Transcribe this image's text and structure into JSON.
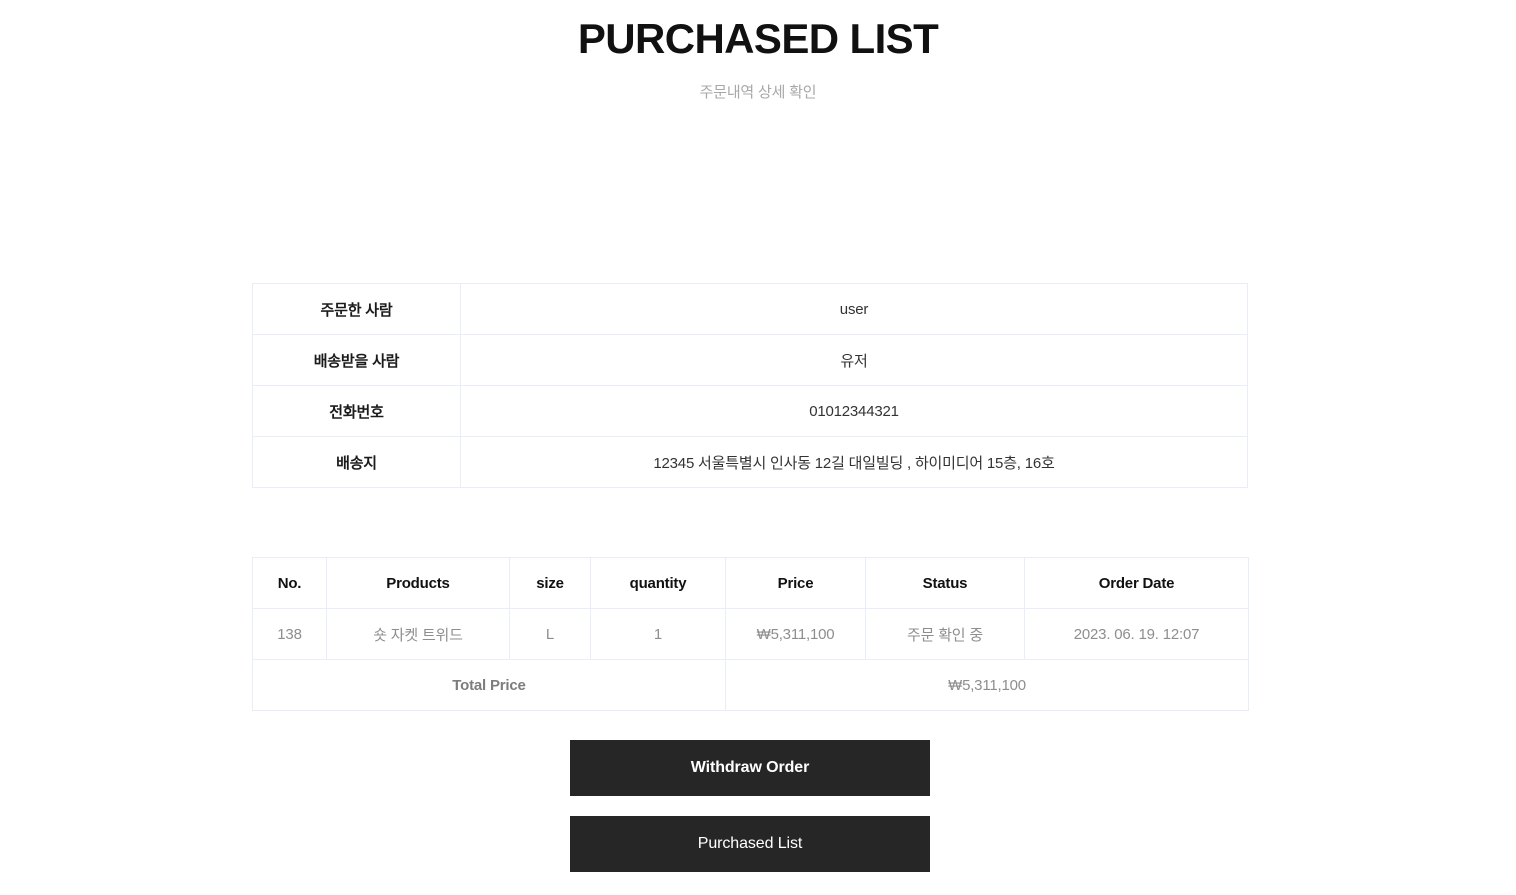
{
  "header": {
    "title": "PURCHASED LIST",
    "subtitle": "주문내역 상세 확인"
  },
  "order_info": {
    "rows": [
      {
        "label": "주문한 사람",
        "value": "user"
      },
      {
        "label": "배송받을 사람",
        "value": "유저"
      },
      {
        "label": "전화번호",
        "value": "01012344321"
      },
      {
        "label": "배송지",
        "value": "12345 서울특별시 인사동 12길 대일빌딩 , 하이미디어 15층, 16호"
      }
    ]
  },
  "order_table": {
    "columns": [
      "No.",
      "Products",
      "size",
      "quantity",
      "Price",
      "Status",
      "Order Date"
    ],
    "rows": [
      {
        "no": "138",
        "product": "숏 자켓 트위드",
        "size": "L",
        "quantity": "1",
        "price": "₩5,311,100",
        "status": "주문 확인 중",
        "order_date": "2023. 06. 19. 12:07"
      }
    ],
    "total_label": "Total Price",
    "total_value": "₩5,311,100"
  },
  "actions": {
    "withdraw_label": "Withdraw Order",
    "purchased_label": "Purchased List"
  },
  "colors": {
    "button_background": "#262626",
    "table_border": "#e9edfa",
    "title_text": "#111111",
    "subtitle_text": "#a8a8a8",
    "muted_text": "#8e8e8e"
  }
}
